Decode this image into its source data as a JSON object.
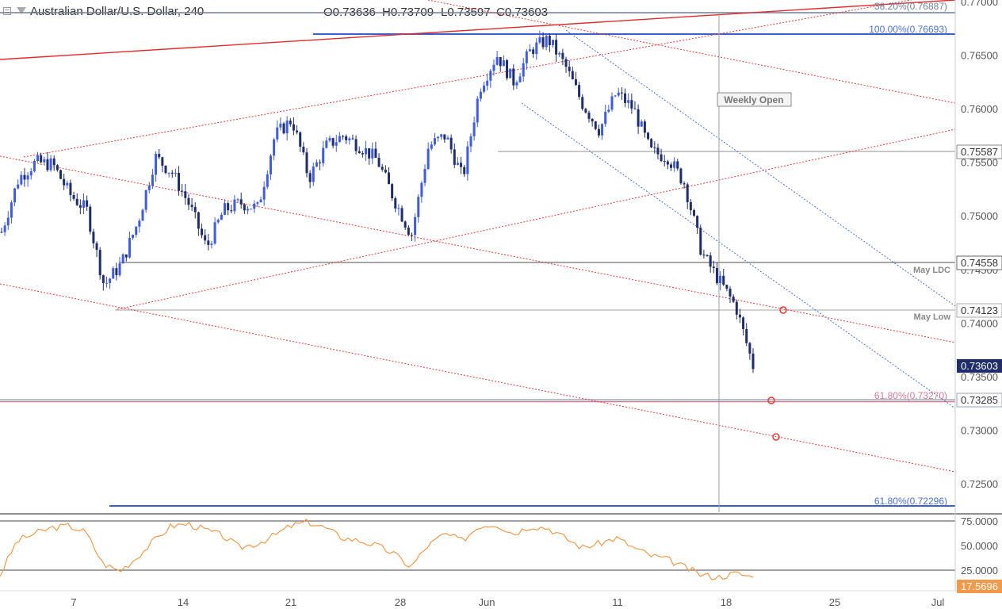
{
  "header": {
    "title": "Australian Dollar/U.S. Dollar, 240",
    "open": "O0.73636",
    "high": "H0.73709",
    "low": "L0.73597",
    "close": "C0.73603"
  },
  "colors": {
    "up_candle": "#3d5ce0",
    "down_candle": "#1f2d6b",
    "red_line": "#e02b2b",
    "fib_blue": "#4a70d6",
    "fib_pink": "#d07a92",
    "grey_level": "#a9a9a9",
    "rsi_line": "#f2994a",
    "price_tag": "#1f2d6b"
  },
  "chart_data": [
    {
      "type": "candlestick",
      "title": "Australian Dollar/U.S. Dollar, 240",
      "x_tick_labels": [
        "7",
        "14",
        "21",
        "28",
        "Jun",
        "11",
        "18",
        "25",
        "Jul"
      ],
      "y_tick_labels": [
        "0.77000",
        "0.76500",
        "0.76000",
        "0.75500",
        "0.75000",
        "0.74500",
        "0.74000",
        "0.73500",
        "0.73000",
        "0.72500"
      ],
      "ylim": [
        0.7225,
        0.77
      ],
      "close_path": [
        [
          "start",
          0.7485
        ],
        [
          "May 3",
          0.7535
        ],
        [
          "May 4",
          0.755
        ],
        [
          "May 5",
          0.7548
        ],
        [
          "May 7",
          0.752
        ],
        [
          "May 8",
          0.7505
        ],
        [
          "May 9",
          0.7435
        ],
        [
          "May 10",
          0.7455
        ],
        [
          "May 11",
          0.7495
        ],
        [
          "May 13",
          0.7555
        ],
        [
          "May 14",
          0.754
        ],
        [
          "May 15",
          0.751
        ],
        [
          "May 16",
          0.747
        ],
        [
          "May 17",
          0.7505
        ],
        [
          "May 18",
          0.7512
        ],
        [
          "May 20",
          0.7507
        ],
        [
          "May 21",
          0.7575
        ],
        [
          "May 22",
          0.759
        ],
        [
          "May 23",
          0.7535
        ],
        [
          "May 24",
          0.7565
        ],
        [
          "May 25",
          0.7575
        ],
        [
          "May 27",
          0.7565
        ],
        [
          "May 28",
          0.7552
        ],
        [
          "May 29",
          0.7515
        ],
        [
          "May 30",
          0.7482
        ],
        [
          "May 31",
          0.7565
        ],
        [
          "Jun 1",
          0.7575
        ],
        [
          "Jun 2",
          0.7535
        ],
        [
          "Jun 3",
          0.762
        ],
        [
          "Jun 4",
          0.765
        ],
        [
          "Jun 5",
          0.7625
        ],
        [
          "Jun 6",
          0.7655
        ],
        [
          "Jun 7",
          0.7665
        ],
        [
          "Jun 8",
          0.764
        ],
        [
          "Jun 10",
          0.7605
        ],
        [
          "Jun 11",
          0.758
        ],
        [
          "Jun 12",
          0.7615
        ],
        [
          "Jun 13",
          0.76
        ],
        [
          "Jun 14",
          0.756
        ],
        [
          "Jun 15",
          0.7555
        ],
        [
          "Jun 16",
          0.753
        ],
        [
          "Jun 17",
          0.7465
        ],
        [
          "Jun 18",
          0.744
        ],
        [
          "Jun 19",
          0.7415
        ],
        [
          "Jun 20",
          0.736
        ]
      ],
      "last_price": "0.73603"
    },
    {
      "type": "line",
      "title": "RSI",
      "y_tick_labels": [
        "75.0000",
        "50.0000",
        "25.0000"
      ],
      "ylim": [
        10,
        80
      ],
      "series": [
        {
          "values": [
            20,
            55,
            62,
            68,
            70,
            64,
            32,
            24,
            38,
            55,
            70,
            72,
            66,
            60,
            48,
            52,
            60,
            70,
            74,
            68,
            58,
            55,
            50,
            42,
            28,
            50,
            62,
            55,
            70,
            72,
            62,
            70,
            68,
            58,
            48,
            52,
            58,
            48,
            40,
            36,
            28,
            20,
            18,
            22,
            17.57
          ]
        }
      ],
      "last_value": "17.5696"
    }
  ],
  "annotations": {
    "fib_382": "38.20%(0.76887)",
    "fib_100": "100.00%(0.76693)",
    "level_7558": "0.75587",
    "weekly_open": "Weekly Open",
    "may_ldc": "May LDC",
    "level_7455": "0.74558",
    "may_low": "May Low",
    "level_7412": "0.74123",
    "last_price_tag": "0.73603",
    "fib_618_upper": "61.80%(0.73270)",
    "level_7328": "0.73285",
    "fib_618_lower": "61.80%(0.72296)",
    "rsi_last_tag": "17.5696"
  }
}
